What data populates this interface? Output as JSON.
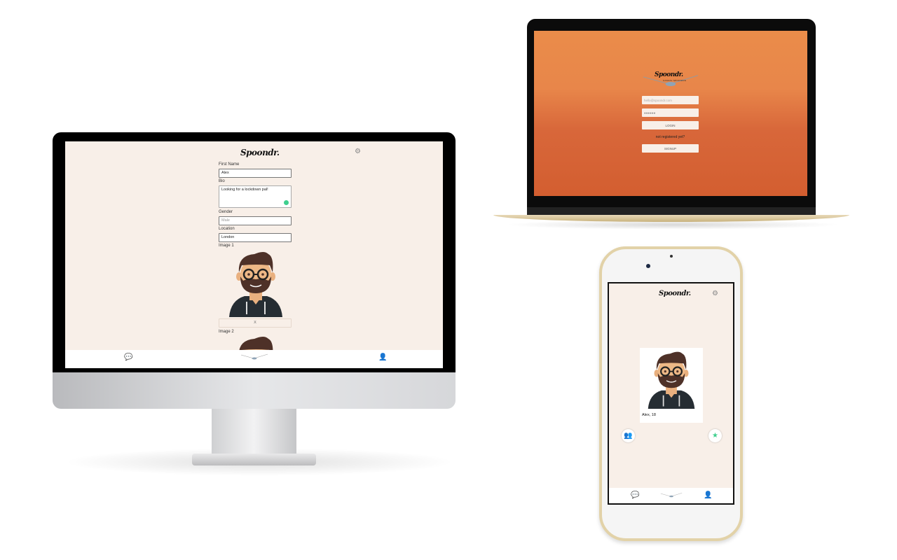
{
  "brand": {
    "logo": "Spoondr.",
    "tagline": "CASUAL SPOONING"
  },
  "desktop": {
    "form": {
      "first_name_label": "First Name",
      "first_name_value": "Alex",
      "bio_label": "Bio",
      "bio_value": "Looking for a lockdown pal!",
      "gender_label": "Gender",
      "gender_placeholder": "Male",
      "location_label": "Location",
      "location_value": "London",
      "image1_label": "Image 1",
      "remove_image_label": "X",
      "image2_label": "Image 2"
    },
    "nav": {
      "icons": [
        "chat-icon",
        "spoons-icon",
        "profile-icon"
      ]
    }
  },
  "laptop": {
    "login": {
      "email_placeholder": "hello@spoondr.com",
      "password_value": "●●●●●●",
      "login_button": "LOGIN",
      "not_registered": "not registered yet?",
      "signup_button": "SIGNUP"
    },
    "colors": {
      "gradient_top": "#ea8c4a",
      "gradient_bottom": "#d35e30"
    }
  },
  "phone": {
    "card": {
      "caption": "Alex, 18"
    },
    "actions": {
      "left_icon": "group-icon",
      "right_icon": "star-icon"
    },
    "colors": {
      "group": "#f0c040",
      "star": "#3fcf8e"
    }
  },
  "colors": {
    "app_bg": "#f8efe8",
    "accent_green": "#3fcf8e"
  }
}
